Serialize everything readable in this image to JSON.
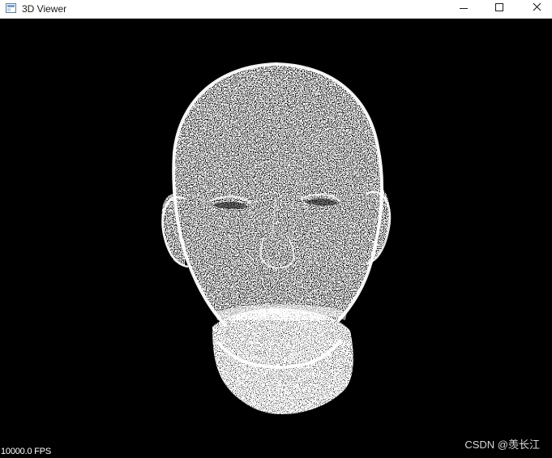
{
  "window": {
    "title": "3D Viewer",
    "icon": "app-window-icon",
    "controls": {
      "minimize_icon": "minimize-icon",
      "maximize_icon": "maximize-icon",
      "close_icon": "close-icon"
    }
  },
  "viewport": {
    "background": "#000000",
    "point_color": "#ffffff",
    "model": "point-cloud-head",
    "fps_label": "10000.0 FPS",
    "watermark": "CSDN @羡长江"
  }
}
